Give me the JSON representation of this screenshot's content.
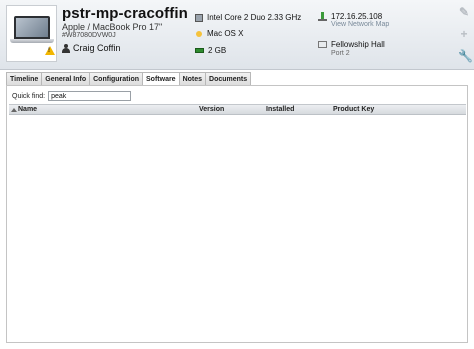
{
  "device": {
    "title": "pstr-mp-cracoffin",
    "model": "Apple / MacBook Pro 17\"",
    "serial": "#W87080DVW0J",
    "user": "Craig Coffin"
  },
  "specs": {
    "cpu": "Intel Core 2 Duo 2.33 GHz",
    "os": "Mac OS X",
    "ram": "2 GB"
  },
  "network": {
    "ip": "172.16.25.108",
    "map_link": "View Network Map",
    "location": "Fellowship Hall",
    "port": "Port 2"
  },
  "tools": {
    "edit_icon": "pencil-icon",
    "add_icon": "plus-icon",
    "settings_icon": "wrench-icon"
  },
  "tabs": [
    {
      "label": "Timeline"
    },
    {
      "label": "General Info"
    },
    {
      "label": "Configuration"
    },
    {
      "label": "Software",
      "active": true
    },
    {
      "label": "Notes"
    },
    {
      "label": "Documents"
    }
  ],
  "software": {
    "quick_find_label": "Quick find:",
    "quick_find_value": "peak",
    "columns": [
      "Name",
      "Version",
      "Installed",
      "Product Key"
    ],
    "rows": []
  },
  "colors": {
    "header_bg": "#e6eaee",
    "warning": "#f2b600",
    "network_green": "#3b9a3b"
  }
}
